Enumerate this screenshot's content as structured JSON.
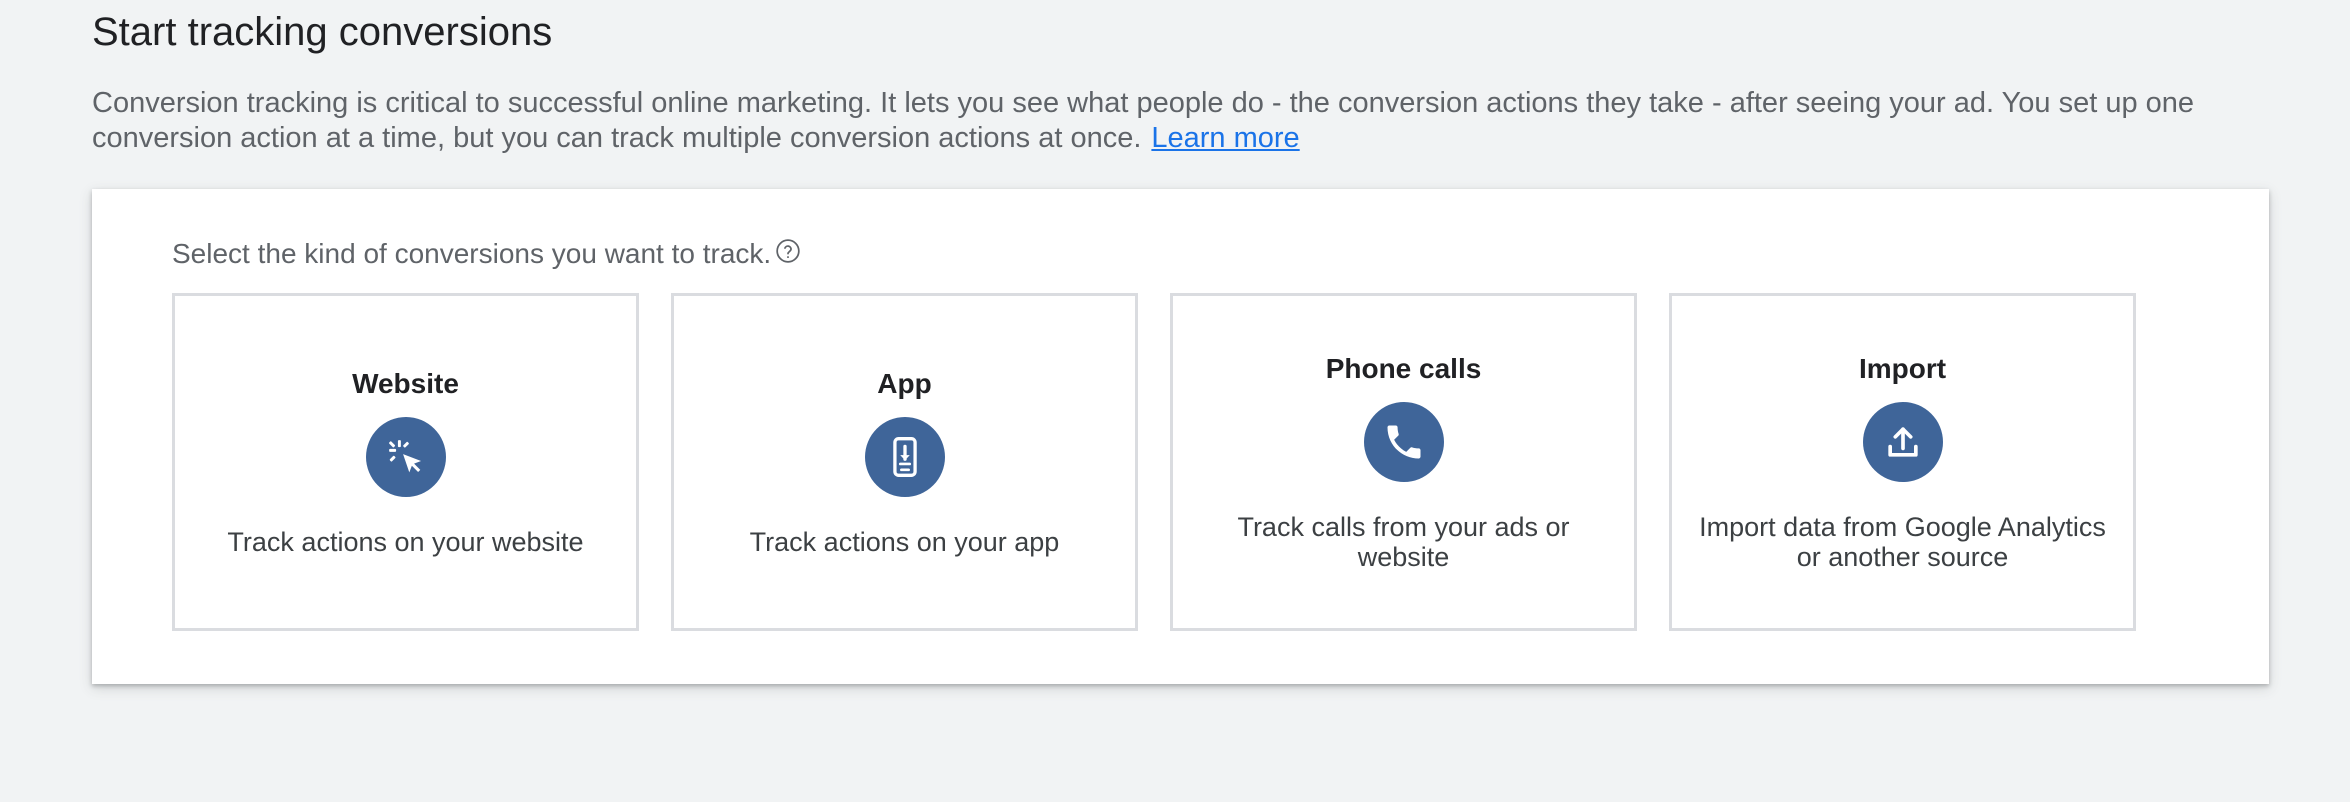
{
  "header": {
    "title": "Start tracking conversions",
    "intro_text": "Conversion tracking is critical to successful online marketing. It lets you see what people do - the conversion actions they take - after seeing your ad. You set up one conversion action at a time, but you can track multiple conversion actions at once.",
    "learn_more": "Learn more"
  },
  "selector": {
    "prompt": "Select the kind of conversions you want to track.",
    "help_icon": "help-circle-icon",
    "accent_color": "#3f6599",
    "options": [
      {
        "title": "Website",
        "icon": "cursor-click-icon",
        "description": "Track actions on your website"
      },
      {
        "title": "App",
        "icon": "phone-download-icon",
        "description": "Track actions on your app"
      },
      {
        "title": "Phone calls",
        "icon": "phone-icon",
        "description": "Track calls from your ads or website"
      },
      {
        "title": "Import",
        "icon": "upload-icon",
        "description": "Import data from Google Analytics or another source"
      }
    ]
  }
}
